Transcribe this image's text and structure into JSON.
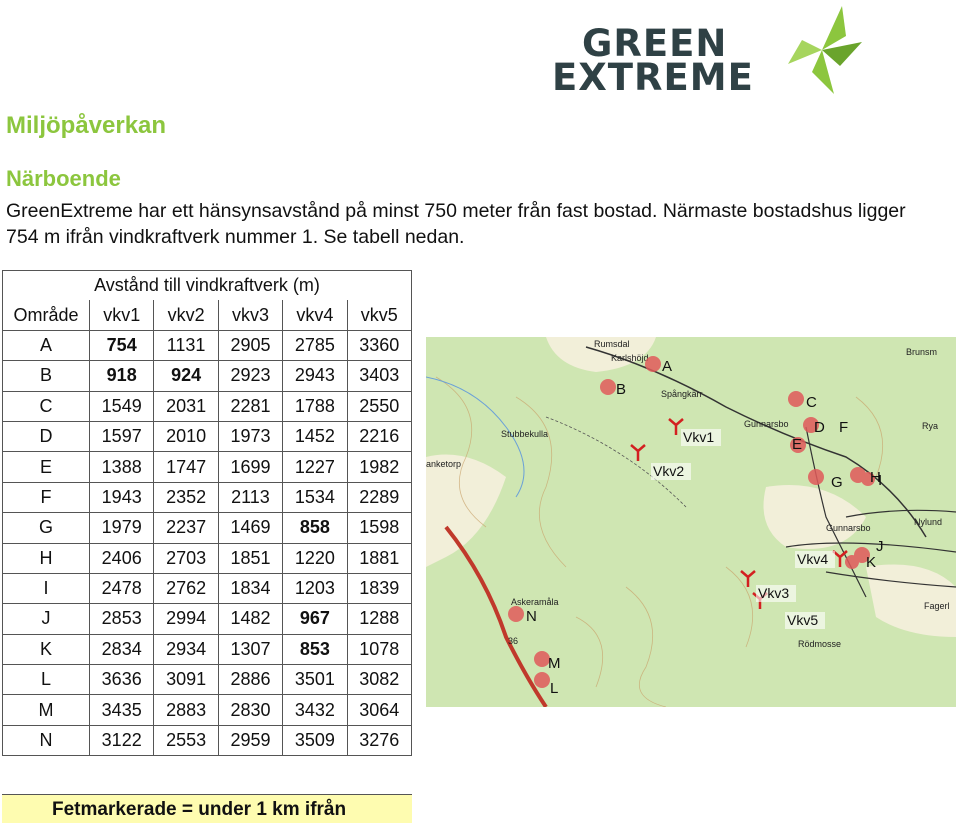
{
  "logo": {
    "line1": "GREEN",
    "line2": "EXTREME"
  },
  "heading": "Miljöpåverkan",
  "subheading": "Närboende",
  "paragraph": "GreenExtreme har ett hänsynsavstånd på minst 750 meter från fast bostad. Närmaste bostadshus ligger 754 m ifrån vindkraftverk nummer 1. Se tabell nedan.",
  "table": {
    "title": "Avstånd till vindkraftverk (m)",
    "headers": [
      "Område",
      "vkv1",
      "vkv2",
      "vkv3",
      "vkv4",
      "vkv5"
    ],
    "rows": [
      {
        "area": "A",
        "values": [
          "754",
          "1131",
          "2905",
          "2785",
          "3360"
        ]
      },
      {
        "area": "B",
        "values": [
          "918",
          "924",
          "2923",
          "2943",
          "3403"
        ]
      },
      {
        "area": "C",
        "values": [
          "1549",
          "2031",
          "2281",
          "1788",
          "2550"
        ]
      },
      {
        "area": "D",
        "values": [
          "1597",
          "2010",
          "1973",
          "1452",
          "2216"
        ]
      },
      {
        "area": "E",
        "values": [
          "1388",
          "1747",
          "1699",
          "1227",
          "1982"
        ]
      },
      {
        "area": "F",
        "values": [
          "1943",
          "2352",
          "2113",
          "1534",
          "2289"
        ]
      },
      {
        "area": "G",
        "values": [
          "1979",
          "2237",
          "1469",
          "858",
          "1598"
        ]
      },
      {
        "area": "H",
        "values": [
          "2406",
          "2703",
          "1851",
          "1220",
          "1881"
        ]
      },
      {
        "area": "I",
        "values": [
          "2478",
          "2762",
          "1834",
          "1203",
          "1839"
        ]
      },
      {
        "area": "J",
        "values": [
          "2853",
          "2994",
          "1482",
          "967",
          "1288"
        ]
      },
      {
        "area": "K",
        "values": [
          "2834",
          "2934",
          "1307",
          "853",
          "1078"
        ]
      },
      {
        "area": "L",
        "values": [
          "3636",
          "3091",
          "2886",
          "3501",
          "3082"
        ]
      },
      {
        "area": "M",
        "values": [
          "3435",
          "2883",
          "2830",
          "3432",
          "3064"
        ]
      },
      {
        "area": "N",
        "values": [
          "3122",
          "2553",
          "2959",
          "3509",
          "3276"
        ]
      }
    ]
  },
  "legend": "Fetmarkerade = under 1 km ifrån",
  "map": {
    "place_names": [
      "Rumsdal",
      "Karlshöjd",
      "Brunsm",
      "Spångkärr",
      "Stubbekulla",
      "Gunnarsbo",
      "Rya",
      "anketorp",
      "Gunnarsbo",
      "Nylund",
      "Askeramåla",
      "Rödmosse",
      "Fagerl",
      "36"
    ],
    "area_labels": [
      "A",
      "B",
      "C",
      "D",
      "E",
      "F",
      "G",
      "H",
      "I",
      "J",
      "K",
      "L",
      "M",
      "N"
    ],
    "turbine_labels": [
      "Vkv1",
      "Vkv2",
      "Vkv3",
      "Vkv4",
      "Vkv5"
    ],
    "colors": {
      "land": "#cfe6b2",
      "road": "#c0392b",
      "marker": "#e05a5a",
      "turbine": "#d32020"
    }
  }
}
